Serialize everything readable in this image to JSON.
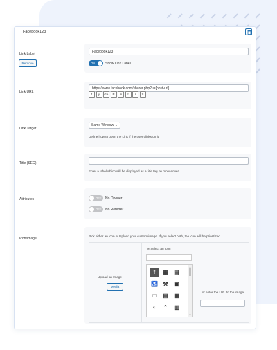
{
  "panel": {
    "title": "Facebook123"
  },
  "link_label": {
    "label": "Link Label",
    "value": "Facebook123",
    "remove_button": "Remove",
    "toggle_text": "ON",
    "show_label": "Show Link Label"
  },
  "link_url": {
    "label": "Link URL",
    "value": "https://www.facebook.com/sharer.php?u=[post-url]",
    "social_buttons": [
      "f",
      "y",
      "G+",
      "P",
      "in",
      "t",
      "r",
      "S"
    ]
  },
  "link_target": {
    "label": "Link Target",
    "selected": "Same Window",
    "help": "Define how to open the Link if the user clicks on it."
  },
  "title_seo": {
    "label": "Title (SEO)",
    "value": "",
    "help": "Enter a label which will be displayed as a title tag on mouseover"
  },
  "attributes": {
    "label": "Attributes",
    "no_opener": "No Opener",
    "no_referrer": "No Referrer",
    "toggle_off_text": "OFF"
  },
  "icon_image": {
    "label": "Icon/Image",
    "help": "Pick either an icon or Upload your custom image. If you select both, the icon will be prioritized.",
    "upload_label": "Upload an Image",
    "media_button": "Media",
    "select_label": "or Select an Icon",
    "url_label": "or enter the URL to the image:",
    "url_value": "",
    "icons": [
      "facebook-icon",
      "image-gallery-icon",
      "bill-icon",
      "accessibility-icon",
      "gavel-icon",
      "id-card-icon",
      "address-book-icon",
      "vcard-icon",
      "contact-card-icon",
      "contrast-icon",
      "chevron-circle-icon",
      "vcard-large-icon"
    ]
  }
}
